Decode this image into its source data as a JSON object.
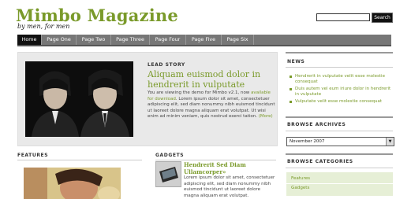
{
  "site": {
    "title": "Mimbo Magazine",
    "tagline": "by men, for men"
  },
  "search": {
    "value": "",
    "button_label": "Search"
  },
  "nav": {
    "items": [
      "Home",
      "Page One",
      "Page Two",
      "Page Three",
      "Page Four",
      "Page Five",
      "Page Six"
    ],
    "active": "Home"
  },
  "lead": {
    "label": "LEAD STORY",
    "title": "Aliquam euismod dolor in hendrerit in vulputate",
    "body_intro": "You are viewing the demo for Mimbo v2.1, now",
    "body_link": "available for download",
    "body_rest": ". Lorem ipsum dolor sit amet, consectetuer adipiscing elit, sed diam nonummy nibh euismod tincidunt ut laoreet dolore magna aliquam erat volutpat. Ut wisi enim ad minim veniam, quis nostrud exerci tation.",
    "more": "(More)"
  },
  "features": {
    "heading": "FEATURES"
  },
  "gadgets": {
    "heading": "GADGETS",
    "title": "Hendrerit Sed Diam Ullamcorper»",
    "body": "Lorem ipsum dolor sit amet, consectetuer adipiscing elit, sed diam nonummy nibh euismod tincidunt ut laoreet dolore magna aliquam erat volutpat."
  },
  "sidebar": {
    "news": {
      "heading": "NEWS",
      "items": [
        "Hendrerit in vulputate velit esse molestie consequat",
        "Duis autem vel eum iriure dolor in hendrerit in vulputate",
        "Vulputate velit esse molestie consequat"
      ]
    },
    "archives": {
      "heading": "BROWSE ARCHIVES",
      "selected": "November 2007"
    },
    "categories": {
      "heading": "BROWSE CATEGORIES",
      "items": [
        "Features",
        "Gadgets"
      ]
    }
  },
  "colors": {
    "accent": "#7a9a2a",
    "nav_bg": "#777777",
    "nav_active": "#111111",
    "lead_bg": "#e9e9e9",
    "category_bg": "#e6efd6"
  }
}
